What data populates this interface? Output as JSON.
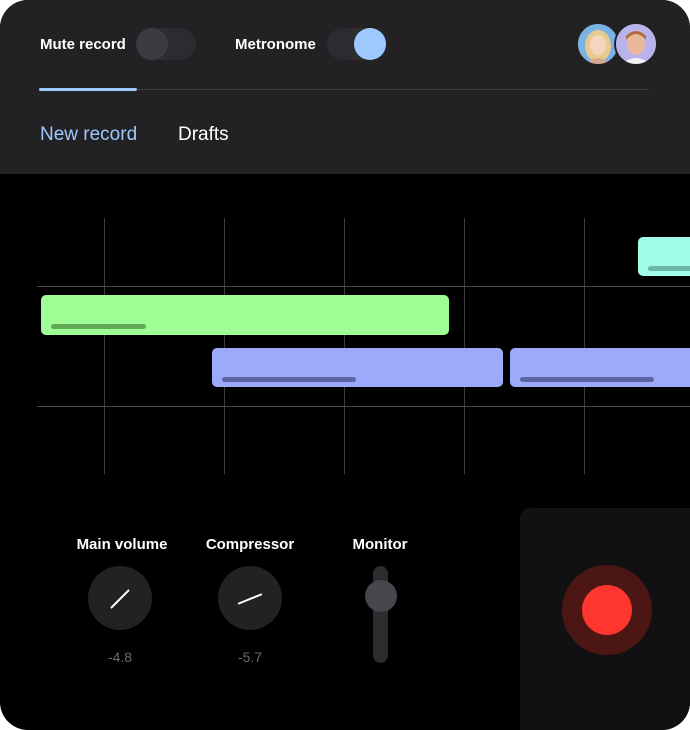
{
  "header": {
    "mute_record": {
      "label": "Mute record",
      "on": false
    },
    "metronome": {
      "label": "Metronome",
      "on": true
    },
    "avatars": [
      {
        "name": "user-avatar-1"
      },
      {
        "name": "user-avatar-2"
      }
    ]
  },
  "tabs": [
    {
      "label": "New record",
      "active": true
    },
    {
      "label": "Drafts",
      "active": false
    }
  ],
  "timeline": {
    "clips": [
      {
        "name": "clip-teal",
        "color": "#9ffce8"
      },
      {
        "name": "clip-green",
        "color": "#9ffe96"
      },
      {
        "name": "clip-blue-1",
        "color": "#9da9fb"
      },
      {
        "name": "clip-blue-2",
        "color": "#9da9fb"
      }
    ]
  },
  "controls": {
    "main_volume": {
      "label": "Main volume",
      "value": "-4.8"
    },
    "compressor": {
      "label": "Compressor",
      "value": "-5.7"
    },
    "monitor": {
      "label": "Monitor"
    }
  },
  "colors": {
    "accent": "#9ec9ff",
    "record": "#ff362d",
    "record_ring": "#4b1614"
  }
}
